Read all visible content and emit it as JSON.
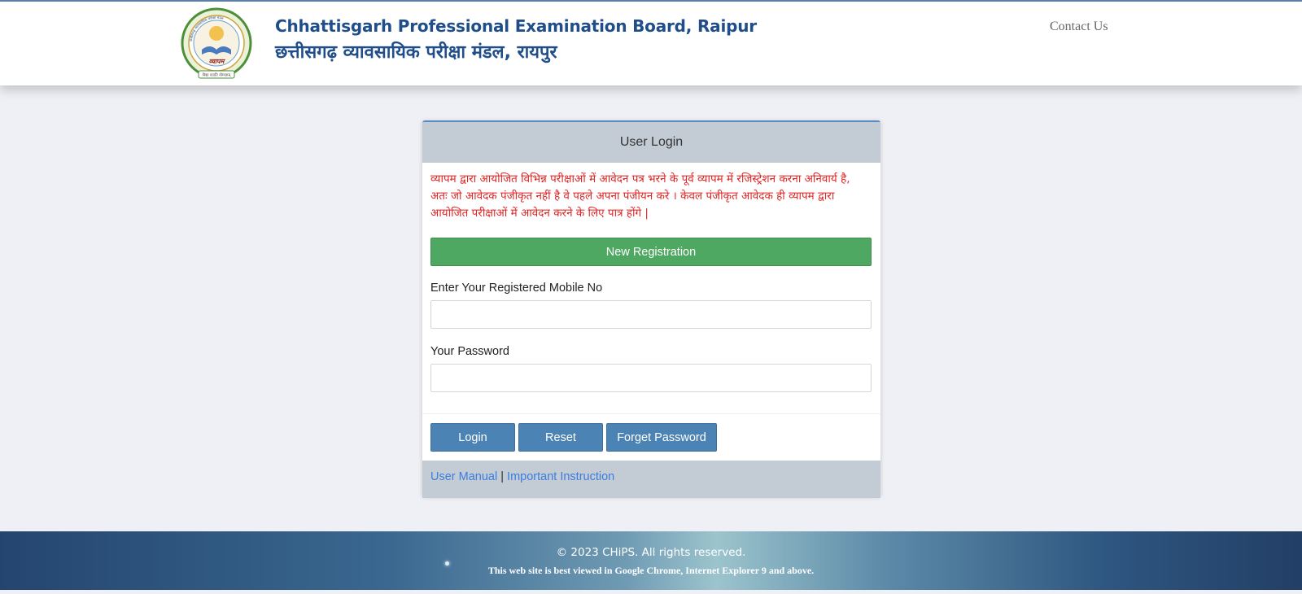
{
  "header": {
    "title_en": "Chhattisgarh Professional Examination Board, Raipur",
    "title_hi": "छत्तीसगढ़ व्यावसायिक परीक्षा मंडल, रायपुर",
    "contact_label": "Contact Us",
    "logo": {
      "icon": "vyapam-emblem-logo",
      "top_text": "छत्तीसगढ़ व्यावसायिक परीक्षा मंडल",
      "center_text": "व्यापम",
      "bottom_text": "विद्या ददाति योग्यताम्"
    }
  },
  "login": {
    "title": "User Login",
    "notice": "व्यापम द्वारा आयोजित विभिन्न  परीक्षाओं में आवेदन पत्र भरने के पूर्व व्यापम में रजिस्ट्रेशन करना अनिवार्य है, अतः जो आवेदक पंजीकृत नहीं है वे पहले अपना  पंजीयन करे ।  केवल पंजीकृत आवेदक ही व्यापम द्वारा आयोजित परीक्षाओं में आवेदन करने के लिए पात्र होंगे |",
    "new_registration_label": "New Registration",
    "mobile_label": "Enter Your Registered Mobile No",
    "mobile_value": "",
    "password_label": "Your Password",
    "password_value": "",
    "buttons": {
      "login": "Login",
      "reset": "Reset",
      "forget": "Forget Password"
    },
    "links": {
      "user_manual": "User Manual",
      "separator": "|",
      "instruction": "Important Instruction"
    }
  },
  "footer": {
    "copyright": "© 2023 CHiPS. All rights reserved.",
    "browser_note": "This web site is best viewed in Google Chrome, Internet Explorer 9 and above."
  },
  "colors": {
    "title": "#1f4e8a",
    "notice": "#e02424",
    "register_button": "#4fa862",
    "action_button": "#4b83b4",
    "link": "#3b7ddd",
    "card_header": "#c3ccd5"
  }
}
